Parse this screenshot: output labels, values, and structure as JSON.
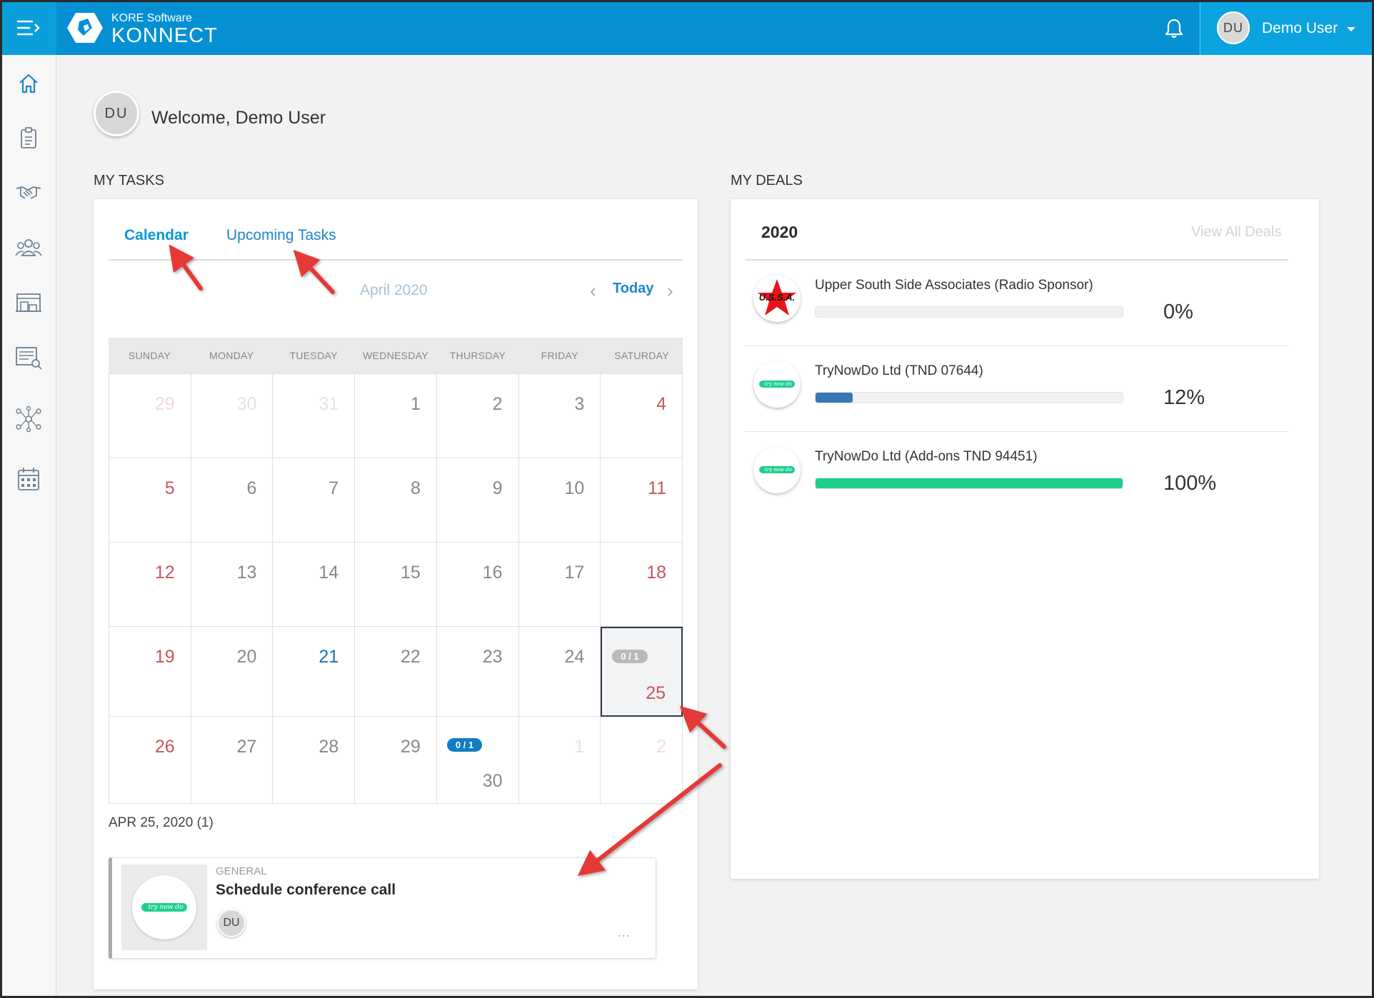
{
  "header": {
    "brand_small": "KORE Software",
    "brand_big": "KONNECT",
    "user_initials": "DU",
    "user_name": "Demo User"
  },
  "sidebar": {
    "items": [
      {
        "icon": "home-icon"
      },
      {
        "icon": "clipboard-icon"
      },
      {
        "icon": "handshake-icon"
      },
      {
        "icon": "contacts-icon"
      },
      {
        "icon": "inventory-icon"
      },
      {
        "icon": "report-search-icon"
      },
      {
        "icon": "network-icon"
      },
      {
        "icon": "calendar-icon"
      }
    ]
  },
  "welcome": {
    "initials": "DU",
    "text": "Welcome, Demo User"
  },
  "tasks": {
    "section_title": "MY TASKS",
    "tabs": [
      "Calendar",
      "Upcoming Tasks"
    ],
    "active_tab": "Calendar",
    "month": "April 2020",
    "today_label": "Today",
    "weekdays": [
      "SUNDAY",
      "MONDAY",
      "TUESDAY",
      "WEDNESDAY",
      "THURSDAY",
      "FRIDAY",
      "SATURDAY"
    ],
    "weeks": [
      [
        {
          "d": "29",
          "o": true
        },
        {
          "d": "30",
          "o": true
        },
        {
          "d": "31",
          "o": true
        },
        {
          "d": "1"
        },
        {
          "d": "2"
        },
        {
          "d": "3"
        },
        {
          "d": "4"
        }
      ],
      [
        {
          "d": "5"
        },
        {
          "d": "6"
        },
        {
          "d": "7"
        },
        {
          "d": "8"
        },
        {
          "d": "9"
        },
        {
          "d": "10"
        },
        {
          "d": "11"
        }
      ],
      [
        {
          "d": "12"
        },
        {
          "d": "13"
        },
        {
          "d": "14"
        },
        {
          "d": "15"
        },
        {
          "d": "16"
        },
        {
          "d": "17"
        },
        {
          "d": "18"
        }
      ],
      [
        {
          "d": "19"
        },
        {
          "d": "20"
        },
        {
          "d": "21",
          "today": true
        },
        {
          "d": "22"
        },
        {
          "d": "23"
        },
        {
          "d": "24"
        },
        {
          "d": "25",
          "selected": true,
          "badge": "0 / 1"
        }
      ],
      [
        {
          "d": "26"
        },
        {
          "d": "27"
        },
        {
          "d": "28"
        },
        {
          "d": "29"
        },
        {
          "d": "30",
          "badge": "0 / 1",
          "badge_color": "blue"
        },
        {
          "d": "1",
          "o": true
        },
        {
          "d": "2",
          "o": true
        }
      ]
    ],
    "selected_date_heading": "APR 25, 2020 (1)",
    "task": {
      "category": "GENERAL",
      "title": "Schedule conference call",
      "assignee_initials": "DU",
      "more_label": "...",
      "logo_text": "try now do"
    }
  },
  "deals": {
    "section_title": "MY DEALS",
    "year": "2020",
    "view_all_label": "View All Deals",
    "items": [
      {
        "name": "Upper South Side Associates (Radio Sponsor)",
        "percent_label": "0%",
        "progress": 0,
        "color": "#3a78b5",
        "logo": "ussa",
        "logo_text": "U.S.S.A."
      },
      {
        "name": "TryNowDo Ltd (TND 07644)",
        "percent_label": "12%",
        "progress": 0.12,
        "color": "#3a78b5",
        "logo": "trynowdo",
        "logo_text": "try now do"
      },
      {
        "name": "TryNowDo Ltd (Add-ons TND 94451)",
        "percent_label": "100%",
        "progress": 1.0,
        "color": "#1ecf8e",
        "logo": "trynowdo",
        "logo_text": "try now do"
      }
    ]
  },
  "colors": {
    "header_blue": "#0590d4",
    "accent": "#0b97d6",
    "weekend_red": "#c5565c",
    "annotation_arrow": "#e53935"
  }
}
